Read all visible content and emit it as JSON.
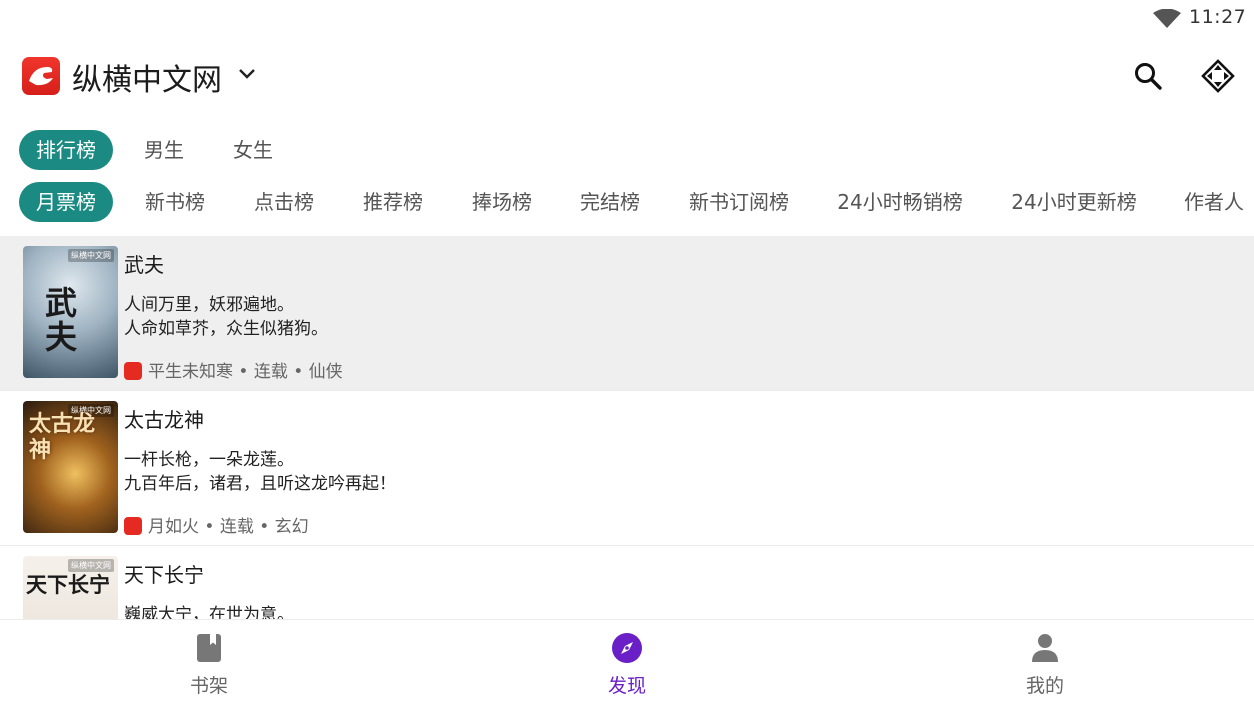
{
  "status_bar": {
    "time": "11:27"
  },
  "header": {
    "app_name": "纵横中文网"
  },
  "category_tabs": [
    {
      "label": "排行榜",
      "active": true
    },
    {
      "label": "男生",
      "active": false
    },
    {
      "label": "女生",
      "active": false
    }
  ],
  "ranking_tabs": [
    {
      "label": "月票榜",
      "active": true
    },
    {
      "label": "新书榜",
      "active": false
    },
    {
      "label": "点击榜",
      "active": false
    },
    {
      "label": "推荐榜",
      "active": false
    },
    {
      "label": "捧场榜",
      "active": false
    },
    {
      "label": "完结榜",
      "active": false
    },
    {
      "label": "新书订阅榜",
      "active": false
    },
    {
      "label": "24小时畅销榜",
      "active": false
    },
    {
      "label": "24小时更新榜",
      "active": false
    },
    {
      "label": "作者人",
      "active": false
    }
  ],
  "books": [
    {
      "title": "武夫",
      "cover_text": "武夫",
      "description": "人间万里，妖邪遍地。\n人命如草芥，众生似猪狗。",
      "meta": "平生未知寒 • 连载 • 仙侠"
    },
    {
      "title": "太古龙神",
      "cover_text": "太古龙神",
      "description": "一杆长枪，一朵龙莲。\n九百年后，诸君，且听这龙吟再起！",
      "meta": "月如火 • 连载 • 玄幻"
    },
    {
      "title": "天下长宁",
      "cover_text": "天下长宁",
      "description": "巍威大宁，在世为意。",
      "meta": ""
    }
  ],
  "cover_brand": "纵横中文网",
  "bottom_nav": [
    {
      "label": "书架",
      "icon": "book-icon",
      "active": false
    },
    {
      "label": "发现",
      "icon": "compass-icon",
      "active": true
    },
    {
      "label": "我的",
      "icon": "person-icon",
      "active": false
    }
  ],
  "colors": {
    "accent": "#1a8a82",
    "nav_active": "#6a1fc7",
    "brand_red": "#e52a22"
  }
}
